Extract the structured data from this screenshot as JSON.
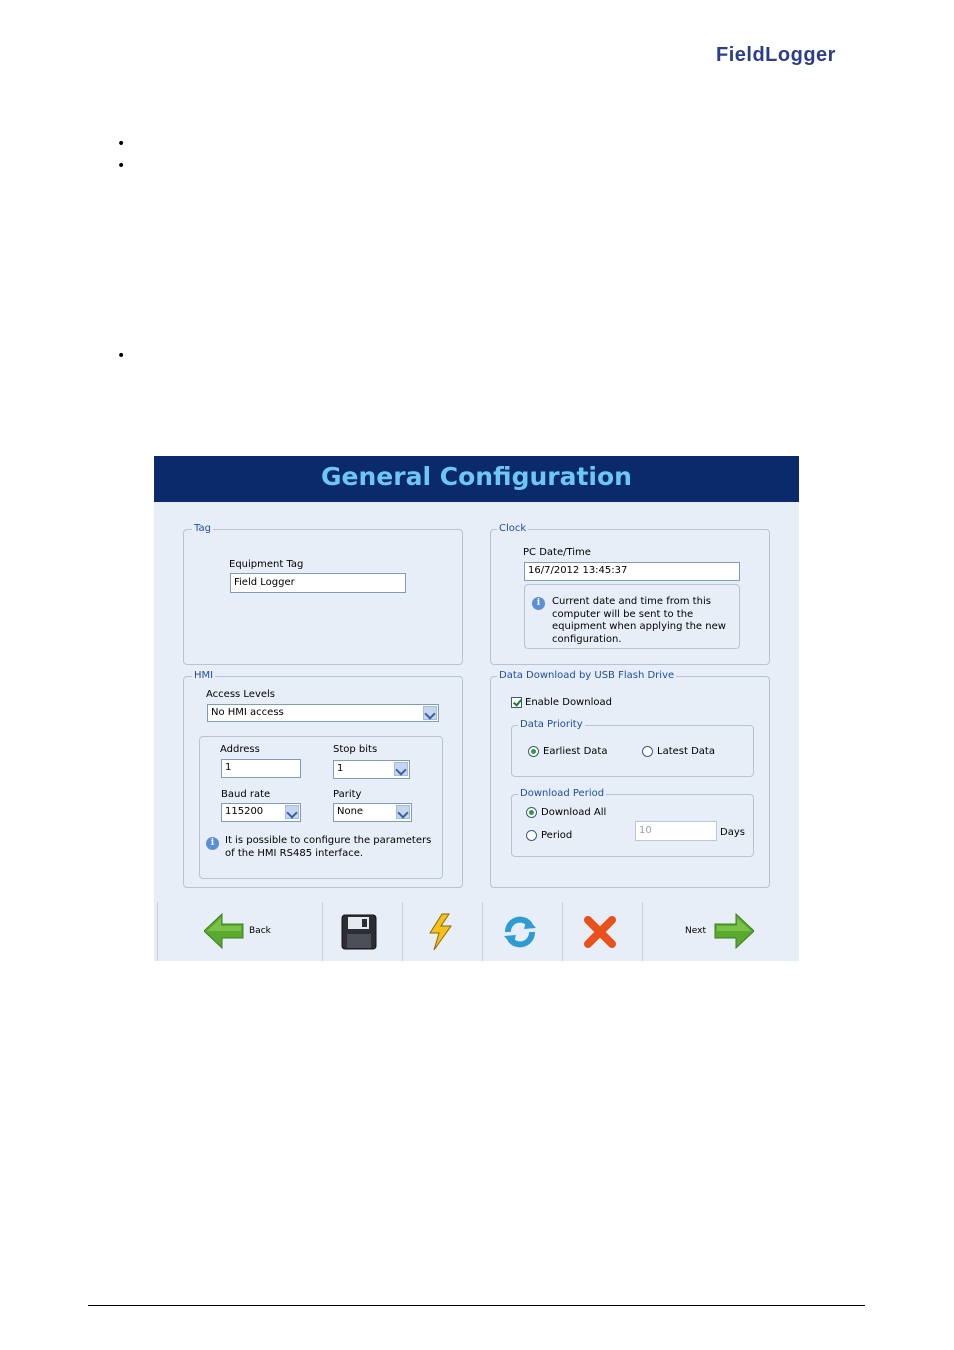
{
  "header": {
    "logo_text": "FieldLogger"
  },
  "bullets": [
    "•",
    "•",
    "•"
  ],
  "window": {
    "title": "General Configuration",
    "tag": {
      "legend": "Tag",
      "equipment_tag_label": "Equipment Tag",
      "equipment_tag_value": "Field Logger"
    },
    "clock": {
      "legend": "Clock",
      "pc_datetime_label": "PC Date/Time",
      "pc_datetime_value": "16/7/2012 13:45:37",
      "info_text": "Current date and time from this computer will be sent to the equipment when applying the new configuration."
    },
    "hmi": {
      "legend": "HMI",
      "access_levels_label": "Access Levels",
      "access_levels_value": "No HMI access",
      "address_label": "Address",
      "address_value": "1",
      "stop_bits_label": "Stop bits",
      "stop_bits_value": "1",
      "baud_rate_label": "Baud rate",
      "baud_rate_value": "115200",
      "parity_label": "Parity",
      "parity_value": "None",
      "info_text": "It is possible to configure the parameters of the HMI RS485 interface."
    },
    "download": {
      "legend": "Data Download by USB Flash Drive",
      "enable_label": "Enable Download",
      "enable_checked": true,
      "priority_legend": "Data Priority",
      "earliest_label": "Earliest Data",
      "latest_label": "Latest Data",
      "priority_selected": "earliest",
      "period_legend": "Download Period",
      "download_all_label": "Download All",
      "period_label": "Period",
      "period_selected": "download_all",
      "days_value": "10",
      "days_label": "Days"
    },
    "toolbar": {
      "back_label": "Back",
      "next_label": "Next"
    }
  },
  "colors": {
    "title_bg": "#0a2a6b",
    "title_text": "#6ec6f3",
    "panel_bg": "#e8eef8",
    "legend_text": "#1f4e9b",
    "arrow_green": "#5aa92f",
    "cancel_red": "#e8501c"
  },
  "icons": [
    "info-icon",
    "back-arrow-icon",
    "save-icon",
    "lightning-icon",
    "refresh-icon",
    "cancel-icon",
    "next-arrow-icon"
  ]
}
